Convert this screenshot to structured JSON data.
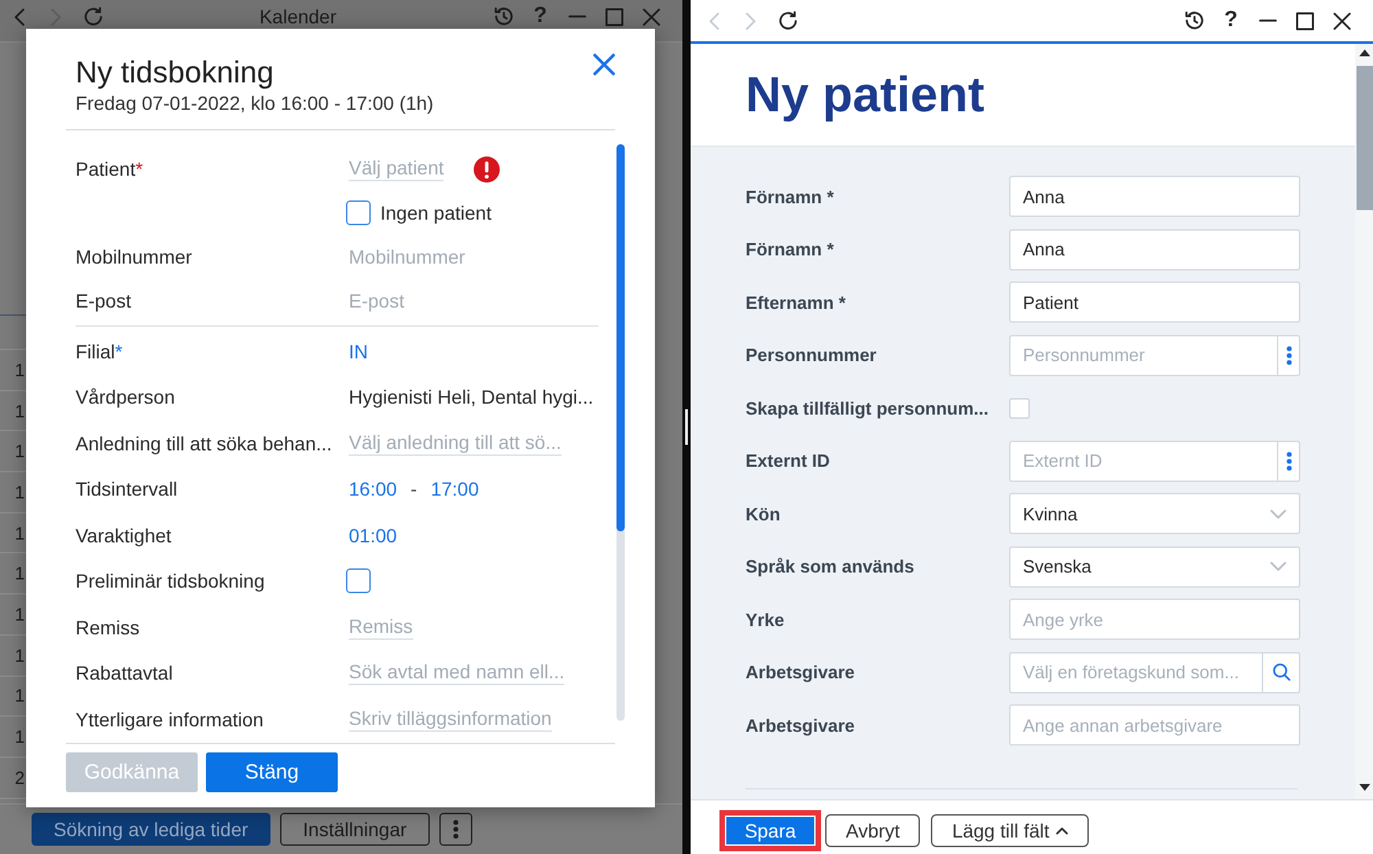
{
  "calendar_window": {
    "nav_buttons": [
      {
        "kind": "back",
        "disabled": false
      },
      {
        "kind": "forward",
        "disabled": true
      },
      {
        "kind": "refresh",
        "disabled": false
      }
    ],
    "title": "Kalender",
    "help": "?",
    "time_column": [
      "1",
      "1",
      "1",
      "1",
      "1",
      "1",
      "1",
      "1",
      "1",
      "1",
      "2"
    ],
    "toolbar_buttons": [
      {
        "kind": "primary",
        "label": "Sökning av lediga tider"
      },
      {
        "kind": "outline",
        "label": "Inställningar"
      },
      {
        "kind": "more"
      }
    ]
  },
  "booking_dialog": {
    "title": "Ny tidsbokning",
    "subtitle": "Fredag 07-01-2022, klo 16:00 - 17:00 (1h)",
    "sections": [
      {
        "rows": [
          {
            "kind": "picker",
            "label": "Patient",
            "asterisk": "*",
            "error": true,
            "placeholder": "Välj patient"
          },
          {
            "kind": "checkbox",
            "text": "Ingen patient",
            "checked": false
          },
          {
            "kind": "input",
            "label": "Mobilnummer",
            "placeholder": "Mobilnummer"
          },
          {
            "kind": "input",
            "label": "E-post",
            "placeholder": "E-post"
          }
        ]
      },
      {
        "rows": [
          {
            "kind": "link",
            "label": "Filial",
            "asterisk": "*",
            "error": false,
            "value": "IN"
          },
          {
            "kind": "text",
            "label": "Vårdperson",
            "value": "Hygienisti Heli, Dental hygi..."
          },
          {
            "kind": "picker",
            "label": "Anledning till att söka behan...",
            "placeholder": "Välj anledning till att sö..."
          },
          {
            "kind": "time_range",
            "label": "Tidsintervall",
            "start": "16:00",
            "separator": "-",
            "end": "17:00"
          },
          {
            "kind": "link",
            "label": "Varaktighet",
            "value": "01:00"
          },
          {
            "kind": "checkbox",
            "label": "Preliminär tidsbokning",
            "checked": false
          },
          {
            "kind": "picker",
            "label": "Remiss",
            "placeholder": "Remiss"
          },
          {
            "kind": "picker",
            "label": "Rabattavtal",
            "placeholder": "Sök avtal med namn ell..."
          },
          {
            "kind": "picker",
            "label": "Ytterligare information",
            "placeholder": "Skriv tilläggsinformation"
          }
        ]
      }
    ],
    "buttons": [
      {
        "label": "Godkänna",
        "disabled": true
      },
      {
        "label": "Stäng",
        "disabled": false
      }
    ]
  },
  "patient_window": {
    "nav_buttons": [
      {
        "kind": "back",
        "disabled": true
      },
      {
        "kind": "forward",
        "disabled": true
      },
      {
        "kind": "refresh",
        "disabled": false
      }
    ],
    "help": "?",
    "title": "Ny patient",
    "fields": [
      {
        "kind": "text",
        "label": "Förnamn *",
        "value": "Anna"
      },
      {
        "kind": "text",
        "label": "Förnamn *",
        "value": "Anna"
      },
      {
        "kind": "text",
        "label": "Efternamn *",
        "value": "Patient"
      },
      {
        "kind": "menu",
        "label": "Personnummer",
        "placeholder": "Personnummer"
      },
      {
        "kind": "checkbox",
        "label": "Skapa tillfälligt personnum...",
        "checked": false
      },
      {
        "kind": "menu",
        "label": "Externt ID",
        "placeholder": "Externt ID"
      },
      {
        "kind": "select",
        "label": "Kön",
        "value": "Kvinna"
      },
      {
        "kind": "select",
        "label": "Språk som används",
        "value": "Svenska"
      },
      {
        "kind": "text",
        "label": "Yrke",
        "placeholder": "Ange yrke"
      },
      {
        "kind": "search",
        "label": "Arbetsgivare",
        "placeholder": "Välj en företagskund som..."
      },
      {
        "kind": "text",
        "label": "Arbetsgivare",
        "placeholder": "Ange annan arbetsgivare"
      }
    ],
    "buttons": [
      {
        "kind": "primary",
        "label": "Spara",
        "highlighted": true
      },
      {
        "kind": "outline",
        "label": "Avbryt",
        "highlighted": false
      },
      {
        "kind": "dropdown",
        "label": "Lägg till fält",
        "highlighted": false
      }
    ]
  }
}
